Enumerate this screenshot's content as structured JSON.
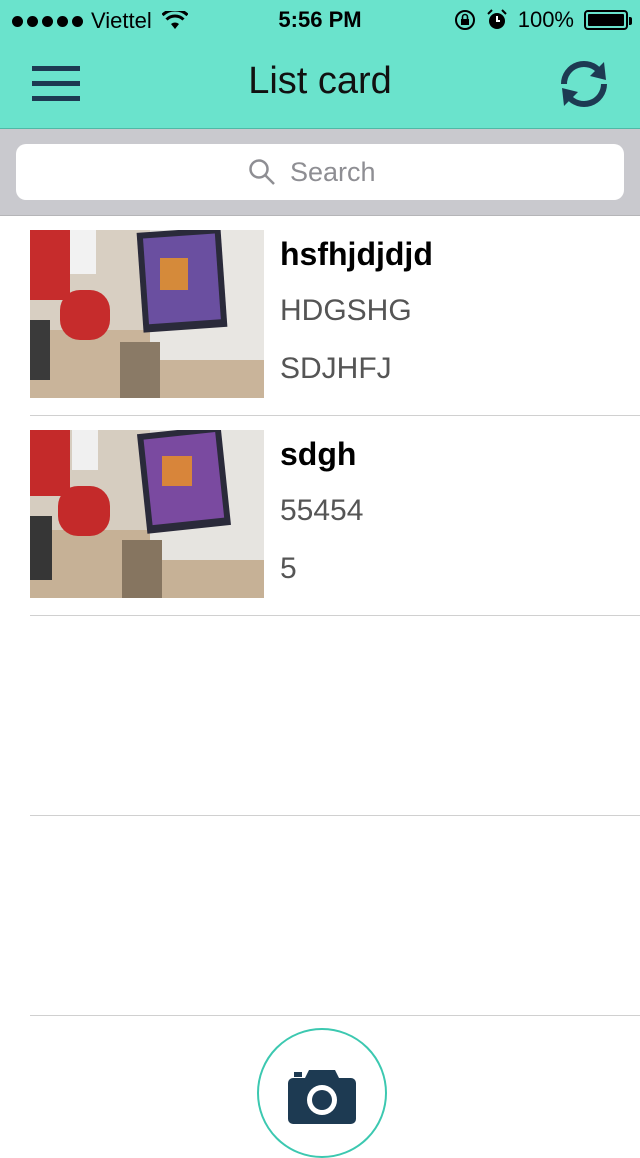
{
  "status_bar": {
    "carrier": "Viettel",
    "time": "5:56 PM",
    "battery": "100%",
    "icons": [
      "signal-dots-icon",
      "wifi-icon",
      "rotation-lock-icon",
      "alarm-icon",
      "battery-icon"
    ]
  },
  "nav": {
    "title": "List card",
    "left_icon": "hamburger-menu-icon",
    "right_icon": "refresh-icon"
  },
  "search": {
    "placeholder": "Search"
  },
  "cards": [
    {
      "title": "hsfhjdjdjd",
      "line2": "HDGSHG",
      "line3": "SDJHFJ"
    },
    {
      "title": "sdgh",
      "line2": "55454",
      "line3": "5"
    }
  ],
  "colors": {
    "nav_background": "#6ae3cc",
    "icon_dark": "#1d3a52",
    "camera_ring": "#3cc8b0"
  }
}
